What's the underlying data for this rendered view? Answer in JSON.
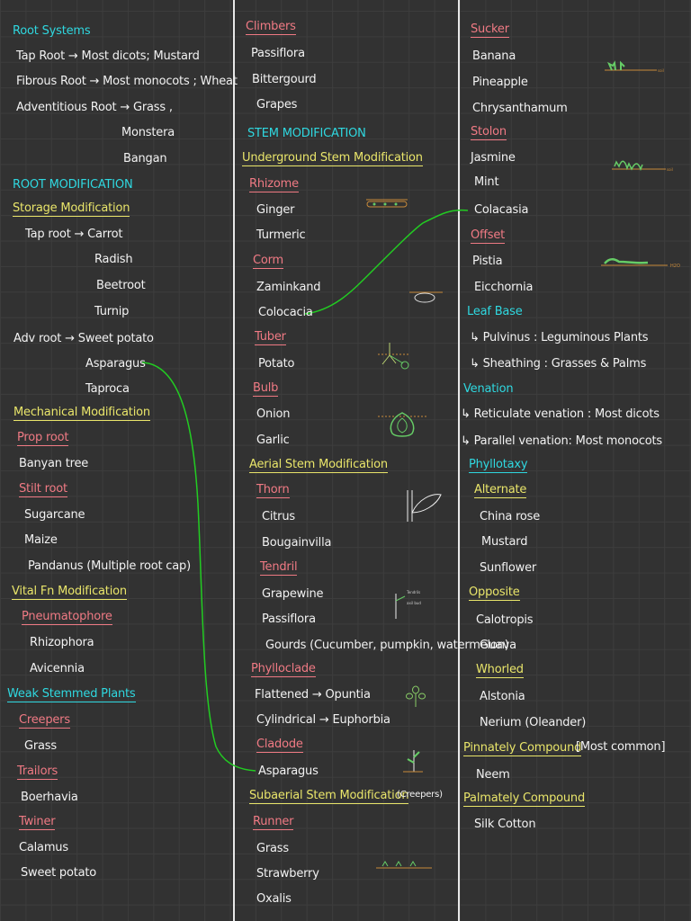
{
  "colors": {
    "background": "#323232",
    "heading": "#2fd8e0",
    "subheading": "#e9e56a",
    "category": "#f07a84",
    "text": "#f2f2f2",
    "link": "#22cc22"
  },
  "col1": [
    {
      "t": "Root Systems",
      "k": "h"
    },
    {
      "t": "Tap Root → Most dicots; Mustard",
      "k": "w"
    },
    {
      "t": "Fibrous Root → Most monocots ; Wheat",
      "k": "w"
    },
    {
      "t": "Adventitious Root → Grass ,",
      "k": "w"
    },
    {
      "t": "Monstera",
      "k": "w"
    },
    {
      "t": "Bangan",
      "k": "w"
    },
    {
      "t": "ROOT MODIFICATION",
      "k": "h"
    },
    {
      "t": "Storage Modification",
      "k": "y"
    },
    {
      "t": "Tap root → Carrot",
      "k": "w"
    },
    {
      "t": "Radish",
      "k": "w"
    },
    {
      "t": "Beetroot",
      "k": "w"
    },
    {
      "t": "Turnip",
      "k": "w"
    },
    {
      "t": "Adv root → Sweet potato",
      "k": "w"
    },
    {
      "t": "Asparagus",
      "k": "w"
    },
    {
      "t": "Taproca",
      "k": "w"
    },
    {
      "t": "Mechanical Modification",
      "k": "y"
    },
    {
      "t": "Prop root",
      "k": "p"
    },
    {
      "t": "Banyan tree",
      "k": "w"
    },
    {
      "t": "Stilt root",
      "k": "p"
    },
    {
      "t": "Sugarcane",
      "k": "w"
    },
    {
      "t": "Maize",
      "k": "w"
    },
    {
      "t": "Pandanus (Multiple root cap)",
      "k": "w"
    },
    {
      "t": "Vital Fn Modification",
      "k": "y"
    },
    {
      "t": "Pneumatophore",
      "k": "p"
    },
    {
      "t": "Rhizophora",
      "k": "w"
    },
    {
      "t": "Avicennia",
      "k": "w"
    },
    {
      "t": "Weak Stemmed Plants",
      "k": "hu"
    },
    {
      "t": "Creepers",
      "k": "p"
    },
    {
      "t": "Grass",
      "k": "w"
    },
    {
      "t": "Trailors",
      "k": "p"
    },
    {
      "t": "Boerhavia",
      "k": "w"
    },
    {
      "t": "Twiner",
      "k": "p"
    },
    {
      "t": "Calamus",
      "k": "w"
    },
    {
      "t": "Sweet potato",
      "k": "w"
    }
  ],
  "col2": [
    {
      "t": "Climbers",
      "k": "p"
    },
    {
      "t": "Passiflora",
      "k": "w"
    },
    {
      "t": "Bittergourd",
      "k": "w"
    },
    {
      "t": "Grapes",
      "k": "w"
    },
    {
      "t": "STEM MODIFICATION",
      "k": "h"
    },
    {
      "t": "Underground Stem Modification",
      "k": "y"
    },
    {
      "t": "Rhizome",
      "k": "p"
    },
    {
      "t": "Ginger",
      "k": "w"
    },
    {
      "t": "Turmeric",
      "k": "w"
    },
    {
      "t": "Corm",
      "k": "p"
    },
    {
      "t": "Zaminkand",
      "k": "w"
    },
    {
      "t": "Colocacia",
      "k": "w"
    },
    {
      "t": "Tuber",
      "k": "p"
    },
    {
      "t": "Potato",
      "k": "w"
    },
    {
      "t": "Bulb",
      "k": "p"
    },
    {
      "t": "Onion",
      "k": "w"
    },
    {
      "t": "Garlic",
      "k": "w"
    },
    {
      "t": "Aerial Stem Modification",
      "k": "y"
    },
    {
      "t": "Thorn",
      "k": "p"
    },
    {
      "t": "Citrus",
      "k": "w"
    },
    {
      "t": "Bougainvilla",
      "k": "w"
    },
    {
      "t": "Tendril",
      "k": "p"
    },
    {
      "t": "Grapewine",
      "k": "w"
    },
    {
      "t": "Passiflora",
      "k": "w"
    },
    {
      "t": "Gourds (Cucumber, pumpkin, watermelon)",
      "k": "w"
    },
    {
      "t": "Phylloclade",
      "k": "p"
    },
    {
      "t": "Flattened → Opuntia",
      "k": "w"
    },
    {
      "t": "Cylindrical → Euphorbia",
      "k": "w"
    },
    {
      "t": "Cladode",
      "k": "p"
    },
    {
      "t": "Asparagus",
      "k": "w"
    },
    {
      "t": "Subaerial Stem Modification",
      "k": "y"
    },
    {
      "t": "(Creepers)",
      "k": "ws"
    },
    {
      "t": "Runner",
      "k": "p"
    },
    {
      "t": "Grass",
      "k": "w"
    },
    {
      "t": "Strawberry",
      "k": "w"
    },
    {
      "t": "Oxalis",
      "k": "w"
    }
  ],
  "col3": [
    {
      "t": "Sucker",
      "k": "p"
    },
    {
      "t": "Banana",
      "k": "w"
    },
    {
      "t": "Pineapple",
      "k": "w"
    },
    {
      "t": "Chrysanthamum",
      "k": "w"
    },
    {
      "t": "Stolon",
      "k": "p"
    },
    {
      "t": "Jasmine",
      "k": "w"
    },
    {
      "t": "Mint",
      "k": "w"
    },
    {
      "t": "Colacasia",
      "k": "w"
    },
    {
      "t": "Offset",
      "k": "p"
    },
    {
      "t": "Pistia",
      "k": "w"
    },
    {
      "t": "Eicchornia",
      "k": "w"
    },
    {
      "t": "Leaf Base",
      "k": "h"
    },
    {
      "t": "↳ Pulvinus :  Leguminous Plants",
      "k": "w"
    },
    {
      "t": "↳ Sheathing :  Grasses & Palms",
      "k": "w"
    },
    {
      "t": "Venation",
      "k": "h"
    },
    {
      "t": "↳ Reticulate venation  :  Most dicots",
      "k": "w"
    },
    {
      "t": "↳ Parallel venation: Most monocots",
      "k": "w"
    },
    {
      "t": "Phyllotaxy",
      "k": "hu"
    },
    {
      "t": "Alternate",
      "k": "y"
    },
    {
      "t": "China rose",
      "k": "w"
    },
    {
      "t": "Mustard",
      "k": "w"
    },
    {
      "t": "Sunflower",
      "k": "w"
    },
    {
      "t": "Opposite",
      "k": "y"
    },
    {
      "t": "Calotropis",
      "k": "w"
    },
    {
      "t": "Guava",
      "k": "w"
    },
    {
      "t": "Whorled",
      "k": "y"
    },
    {
      "t": "Alstonia",
      "k": "w"
    },
    {
      "t": "Nerium (Oleander)",
      "k": "w"
    },
    {
      "t": "Pinnately Compound",
      "k": "y"
    },
    {
      "t": "[Most common]",
      "k": "w"
    },
    {
      "t": "Neem",
      "k": "w"
    },
    {
      "t": "Palmately Compound",
      "k": "y"
    },
    {
      "t": "Silk Cotton",
      "k": "w"
    }
  ],
  "sketch_labels": {
    "sucker": "soil",
    "stolon": "soil",
    "offset": "H2O",
    "tendril_top": "Tendrils",
    "tendril_bottom": "axil bud"
  }
}
